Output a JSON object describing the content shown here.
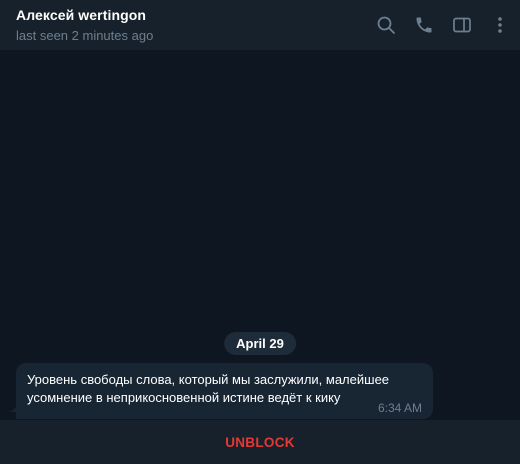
{
  "header": {
    "title": "Алексей wertingon",
    "status": "last seen 2 minutes ago",
    "icons": [
      "search-icon",
      "phone-icon",
      "sidebar-toggle-icon",
      "more-vertical-icon"
    ]
  },
  "chat": {
    "date_label": "April 29",
    "messages": [
      {
        "text": "Уровень свободы слова, который мы заслужили, малейшее усомнение в неприкосновенной истине ведёт к кику",
        "time": "6:34 AM"
      }
    ]
  },
  "footer": {
    "unblock_label": "UNBLOCK"
  },
  "colors": {
    "background": "#0e1621",
    "panel": "#17212b",
    "bubble": "#182533",
    "muted": "#6d7f8f",
    "danger": "#e53935"
  }
}
